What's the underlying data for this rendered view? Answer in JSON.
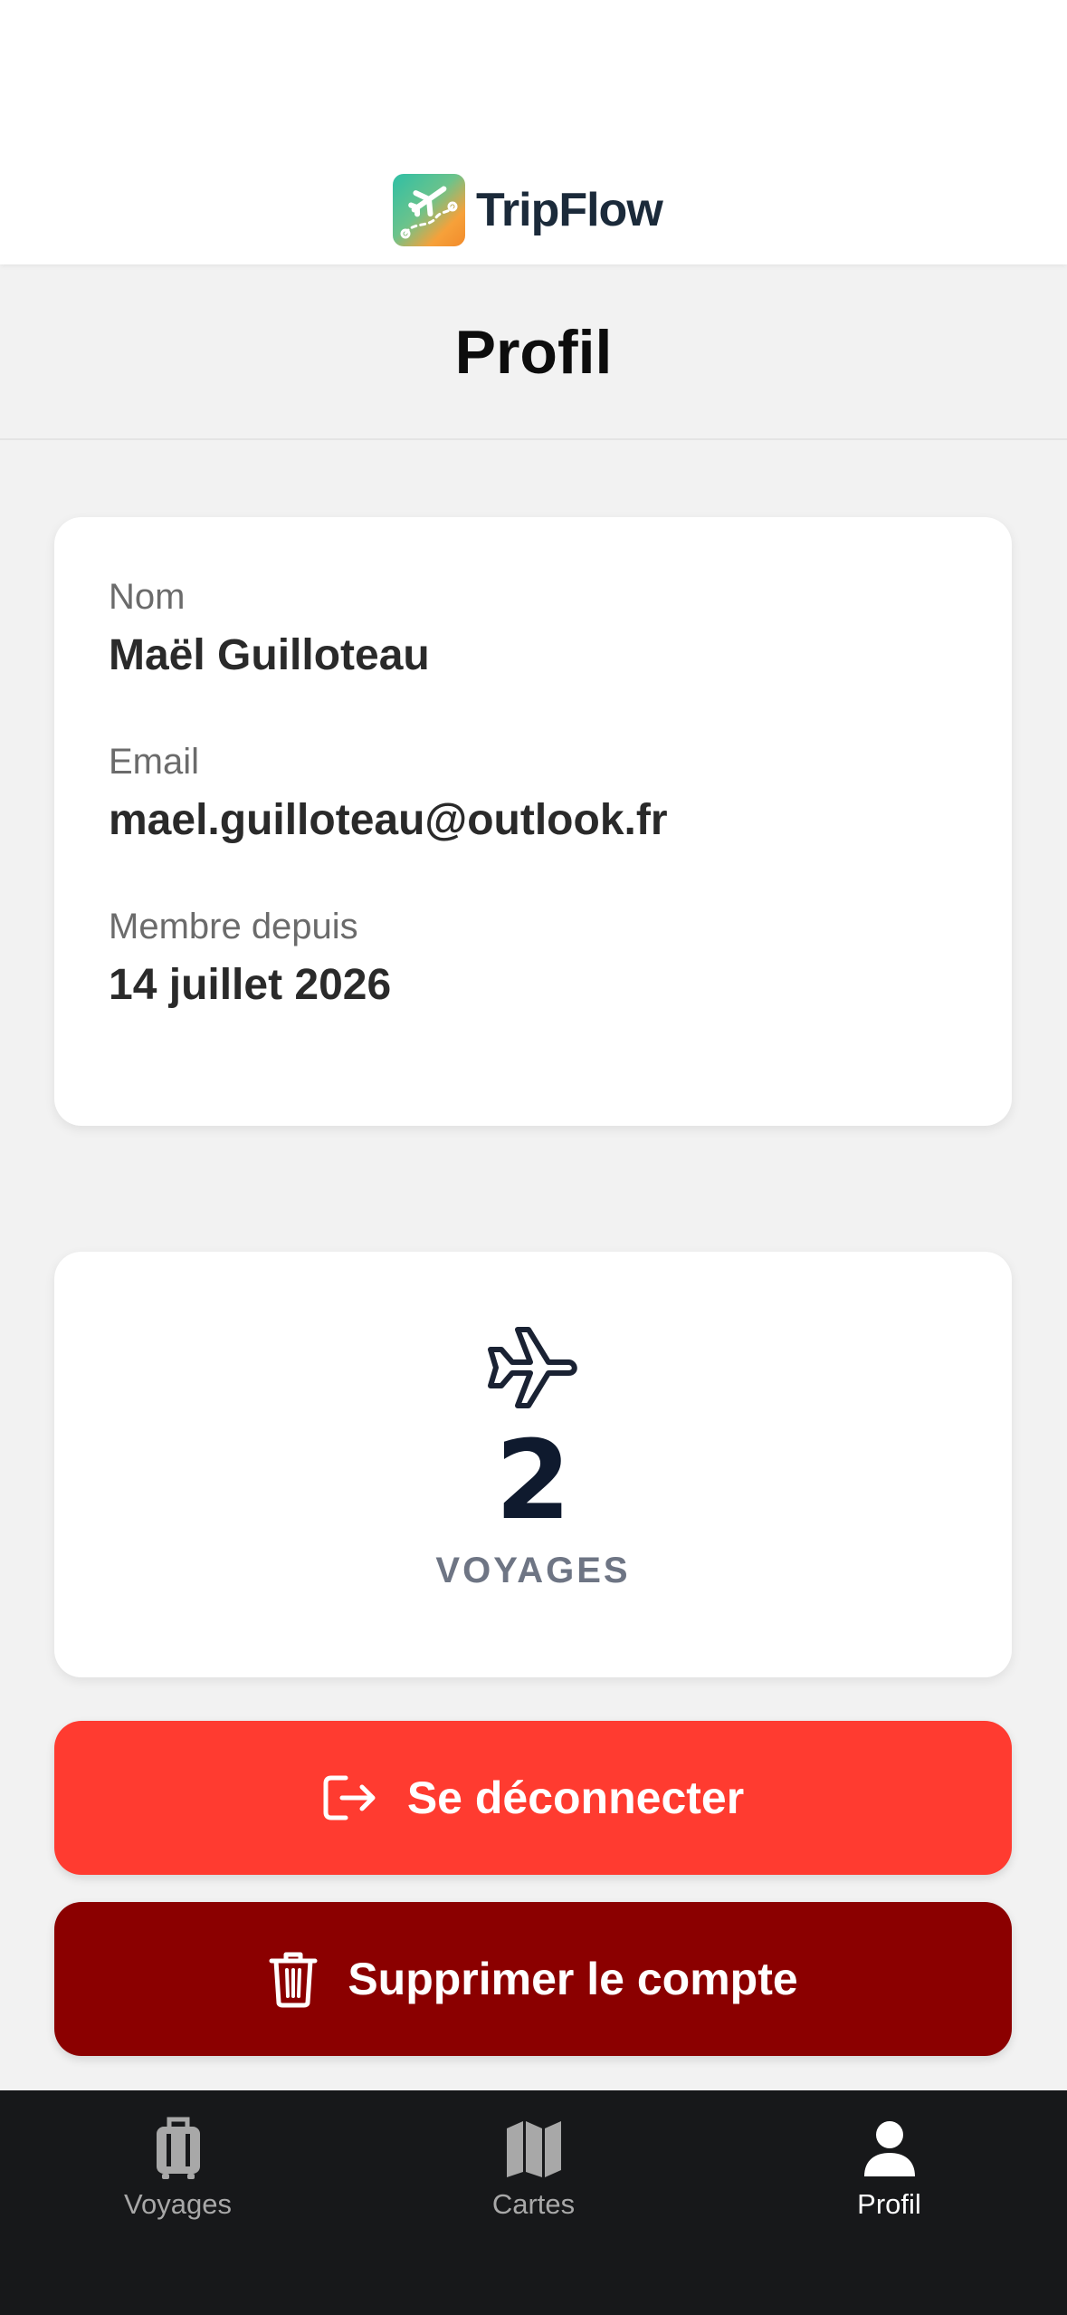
{
  "app": {
    "brand_name": "TripFlow",
    "logo_icon": "plane-route-logo"
  },
  "page": {
    "title": "Profil"
  },
  "profile": {
    "fields": [
      {
        "label": "Nom",
        "value": "Maël Guilloteau"
      },
      {
        "label": "Email",
        "value": "mael.guilloteau@outlook.fr"
      },
      {
        "label": "Membre depuis",
        "value": "14 juillet 2026"
      }
    ]
  },
  "stats": {
    "icon": "plane-icon",
    "count": "2",
    "label": "VOYAGES"
  },
  "actions": {
    "logout_label": "Se déconnecter",
    "logout_icon": "logout-icon",
    "logout_color": "#ff3b30",
    "delete_label": "Supprimer le compte",
    "delete_icon": "trash-icon",
    "delete_color": "#8b0000"
  },
  "tabbar": {
    "items": [
      {
        "label": "Voyages",
        "icon": "suitcase-icon",
        "active": false
      },
      {
        "label": "Cartes",
        "icon": "map-icon",
        "active": false
      },
      {
        "label": "Profil",
        "icon": "person-icon",
        "active": true
      }
    ]
  }
}
